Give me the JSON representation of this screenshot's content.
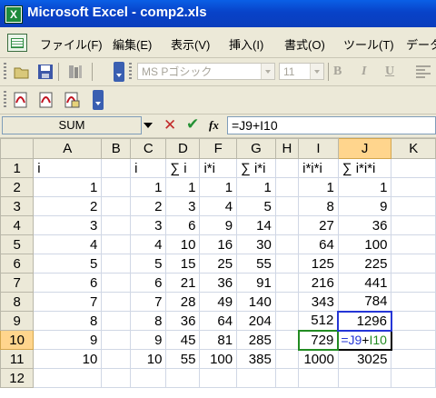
{
  "window": {
    "title": "Microsoft Excel - comp2.xls",
    "app_icon_letter": "X"
  },
  "menu": [
    {
      "label": "ファイル(F)"
    },
    {
      "label": "編集(E)"
    },
    {
      "label": "表示(V)"
    },
    {
      "label": "挿入(I)"
    },
    {
      "label": "書式(O)"
    },
    {
      "label": "ツール(T)"
    },
    {
      "label": "データ"
    }
  ],
  "format_toolbar": {
    "font_name": "MS Pゴシック",
    "font_size": "11",
    "bold": "B",
    "italic": "I",
    "underline": "U"
  },
  "formula_bar": {
    "name_box": "SUM",
    "cancel": "✕",
    "enter": "✔",
    "fx": "fx",
    "formula": "=J9+I10"
  },
  "sheet": {
    "columns": [
      "A",
      "B",
      "C",
      "D",
      "F",
      "G",
      "H",
      "I",
      "J",
      "K"
    ],
    "selected_column": "J",
    "selected_row": "10",
    "rows": [
      {
        "n": "1",
        "cells": [
          "i",
          "",
          "i",
          "∑ i",
          "i*i",
          "∑ i*i",
          "",
          "i*i*i",
          "∑ i*i*i",
          ""
        ]
      },
      {
        "n": "2",
        "cells": [
          "1",
          "",
          "1",
          "1",
          "1",
          "1",
          "",
          "1",
          "1",
          ""
        ]
      },
      {
        "n": "3",
        "cells": [
          "2",
          "",
          "2",
          "3",
          "4",
          "5",
          "",
          "8",
          "9",
          ""
        ]
      },
      {
        "n": "4",
        "cells": [
          "3",
          "",
          "3",
          "6",
          "9",
          "14",
          "",
          "27",
          "36",
          ""
        ]
      },
      {
        "n": "5",
        "cells": [
          "4",
          "",
          "4",
          "10",
          "16",
          "30",
          "",
          "64",
          "100",
          ""
        ]
      },
      {
        "n": "6",
        "cells": [
          "5",
          "",
          "5",
          "15",
          "25",
          "55",
          "",
          "125",
          "225",
          ""
        ]
      },
      {
        "n": "7",
        "cells": [
          "6",
          "",
          "6",
          "21",
          "36",
          "91",
          "",
          "216",
          "441",
          ""
        ]
      },
      {
        "n": "8",
        "cells": [
          "7",
          "",
          "7",
          "28",
          "49",
          "140",
          "",
          "343",
          "784",
          ""
        ]
      },
      {
        "n": "9",
        "cells": [
          "8",
          "",
          "8",
          "36",
          "64",
          "204",
          "",
          "512",
          "1296",
          ""
        ]
      },
      {
        "n": "10",
        "cells": [
          "9",
          "",
          "9",
          "45",
          "81",
          "285",
          "",
          "729",
          "",
          ""
        ]
      },
      {
        "n": "11",
        "cells": [
          "10",
          "",
          "10",
          "55",
          "100",
          "385",
          "",
          "1000",
          "3025",
          ""
        ]
      },
      {
        "n": "12",
        "cells": [
          "",
          "",
          "",
          "",
          "",
          "",
          "",
          "",
          "",
          ""
        ]
      }
    ],
    "editing_cell": {
      "ref_j": "=J9",
      "plus": "+",
      "ref_i": "I10"
    }
  },
  "colors": {
    "title_bar": "#0842c8",
    "ref_blue": "#2536d6",
    "ref_green": "#228b22",
    "header_highlight": "#ffd58d"
  }
}
